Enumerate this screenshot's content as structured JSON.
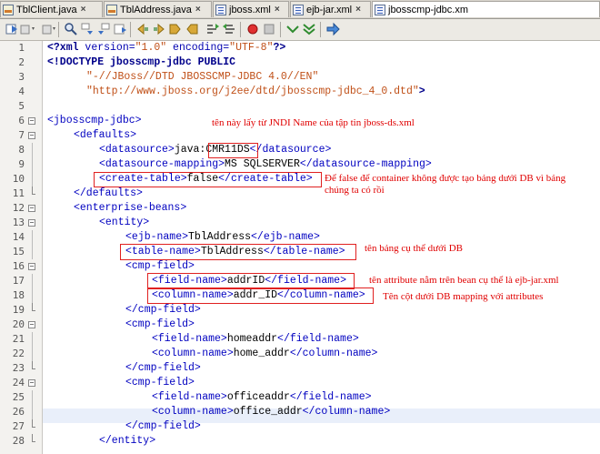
{
  "tabs": [
    {
      "label": "TblClient.java",
      "icon": "java-file-icon",
      "active": false
    },
    {
      "label": "TblAddress.java",
      "icon": "java-file-icon",
      "active": false
    },
    {
      "label": "jboss.xml",
      "icon": "xml-file-icon",
      "active": false
    },
    {
      "label": "ejb-jar.xml",
      "icon": "xml-file-icon",
      "active": false
    },
    {
      "label": "jbosscmp-jdbc.xm",
      "icon": "xml-file-icon",
      "active": true
    }
  ],
  "tab_close_glyph": "×",
  "toolbar_icons": [
    "back-icon",
    "forward-icon",
    "find-icon",
    "find-previous-icon",
    "find-next-icon",
    "toggle-highlight-icon",
    "shift-left-icon",
    "shift-right-icon",
    "comment-icon",
    "uncomment-icon",
    "record-macro-icon",
    "stop-macro-icon",
    "check-xml-icon",
    "validate-xml-icon",
    "run-icon"
  ],
  "line_numbers": [
    "1",
    "2",
    "3",
    "4",
    "5",
    "6",
    "7",
    "8",
    "9",
    "10",
    "11",
    "12",
    "13",
    "14",
    "15",
    "16",
    "17",
    "18",
    "19",
    "20",
    "21",
    "22",
    "23",
    "24",
    "25",
    "26",
    "27",
    "28"
  ],
  "code": {
    "l1_a": "<?xml",
    "l1_b": " version=",
    "l1_c": "\"1.0\"",
    "l1_d": " encoding=",
    "l1_e": "\"UTF-8\"",
    "l1_f": "?>",
    "l2": "<!DOCTYPE jbosscmp-jdbc PUBLIC",
    "l3": "\"-//JBoss//DTD JBOSSCMP-JDBC 4.0//EN\"",
    "l4_a": "\"http://www.jboss.org/j2ee/dtd/jbosscmp-jdbc_4_0.dtd\"",
    "l4_b": ">",
    "l6": "<jbosscmp-jdbc>",
    "l7": "<defaults>",
    "l8_a": "<datasource>",
    "l8_b": "java:",
    "l8_c": "CMR11DS",
    "l8_d": "</datasource>",
    "l9_a": "<datasource-mapping>",
    "l9_b": "MS SQLSERVER",
    "l9_c": "</datasource-mapping>",
    "l10_a": "<create-table>",
    "l10_b": "false",
    "l10_c": "</create-table>",
    "l11": "</defaults>",
    "l12": "<enterprise-beans>",
    "l13": "<entity>",
    "l14_a": "<ejb-name>",
    "l14_b": "TblAddress",
    "l14_c": "</ejb-name>",
    "l15_a": "<table-name>",
    "l15_b": "TblAddress",
    "l15_c": "</table-name>",
    "l16": "<cmp-field>",
    "l17_a": "<field-name>",
    "l17_b": "addrID",
    "l17_c": "</field-name>",
    "l18_a": "<column-name>",
    "l18_b": "addr_ID",
    "l18_c": "</column-name>",
    "l19": "</cmp-field>",
    "l20": "<cmp-field>",
    "l21_a": "<field-name>",
    "l21_b": "homeaddr",
    "l21_c": "</field-name>",
    "l22_a": "<column-name>",
    "l22_b": "home_addr",
    "l22_c": "</column-name>",
    "l23": "</cmp-field>",
    "l24": "<cmp-field>",
    "l25_a": "<field-name>",
    "l25_b": "officeaddr",
    "l25_c": "</field-name>",
    "l26_a": "<column-name>",
    "l26_b": "office_addr",
    "l26_c": "</column-name>",
    "l27": "</cmp-field>",
    "l28": "</entity>"
  },
  "annotations": {
    "datasource_note": "tên này lấy từ JNDI Name của tập tin jboss-ds.xml",
    "create_table_note_1": "Để false để container không được tạo bảng dưới DB vì bảng",
    "create_table_note_2": "chúng ta có rồi",
    "table_name_note": "tên bảng cụ thể dưới DB",
    "field_name_note": "tên attribute nằm trên bean cụ thể là ejb-jar.xml",
    "column_name_note": "Tên cột dưới DB mapping với attributes"
  },
  "colors": {
    "annotation": "#e00000",
    "tag": "#0000c0",
    "string": "#c05018",
    "keyword": "#00008b"
  }
}
